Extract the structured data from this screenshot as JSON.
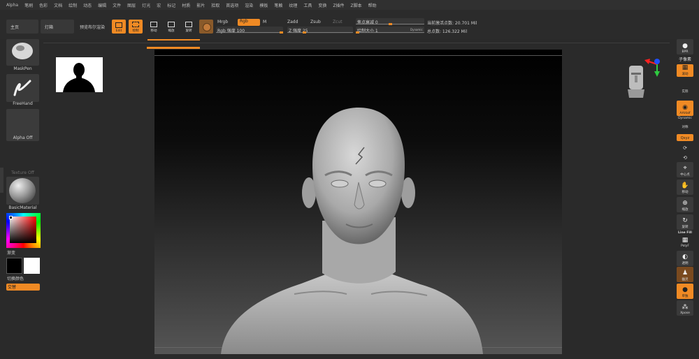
{
  "menu": [
    "Alpha",
    "笔刷",
    "色彩",
    "文档",
    "绘制",
    "动态",
    "编辑",
    "文件",
    "图层",
    "灯光",
    "宏",
    "标记",
    "材质",
    "影片",
    "拾取",
    "首选项",
    "渲染",
    "模板",
    "笔触",
    "纹理",
    "工具",
    "变换",
    "Z插件",
    "Z脚本",
    "帮助"
  ],
  "toolbar": {
    "home": "主页",
    "lightbox": "灯箱",
    "preview_render": "预览布尔渲染",
    "edit": "Edit",
    "draw": "绘制",
    "move": "移动",
    "scale": "缩放",
    "rotate": "旋转",
    "mrgb": "Mrgb",
    "rgb": "Rgb",
    "m": "M",
    "rgb_intensity": "Rgb 强度 100",
    "zadd": "Zadd",
    "zsub": "Zsub",
    "zcut": "Zcut",
    "z_intensity": "Z 强度 25",
    "focal_shift": "焦点衰减 0",
    "draw_size": "绘制大小 1",
    "dynamic": "Dynamic",
    "active_points": "当前激活点数: 20.701 Mil",
    "total_points": "总点数: 126.322 Mil",
    "rgb_intensity_value": 100,
    "z_intensity_value": 25,
    "focal_shift_value": 0,
    "draw_size_value": 1
  },
  "left": {
    "brush": "MaskPen",
    "stroke": "FreeHand",
    "alpha": "Alpha Off",
    "texture": "Texture Off",
    "material": "BasicMaterial",
    "gradient": "渐变",
    "switch_color": "切换颜色",
    "alternate": "交替"
  },
  "right": {
    "bpr": "BPR",
    "subpixel": "子像素",
    "scroll": "滚动",
    "actual": "实际",
    "aahalf": "AAHalf",
    "dynamic": "Dynamic",
    "persp": "对称",
    "xyz": "Qxyz",
    "rotate": "旋转",
    "frame": "中心点",
    "move": "移动",
    "zoom": "缩放",
    "rotate2": "旋转",
    "linefill": "Line Fill",
    "polyf": "PolyF",
    "transp": "透明",
    "ghost": "幽灵",
    "solo": "单独",
    "xpose": "Xpose"
  },
  "colors": {
    "accent": "#f08a24",
    "panel": "#2a2a2a",
    "button": "#383838"
  }
}
